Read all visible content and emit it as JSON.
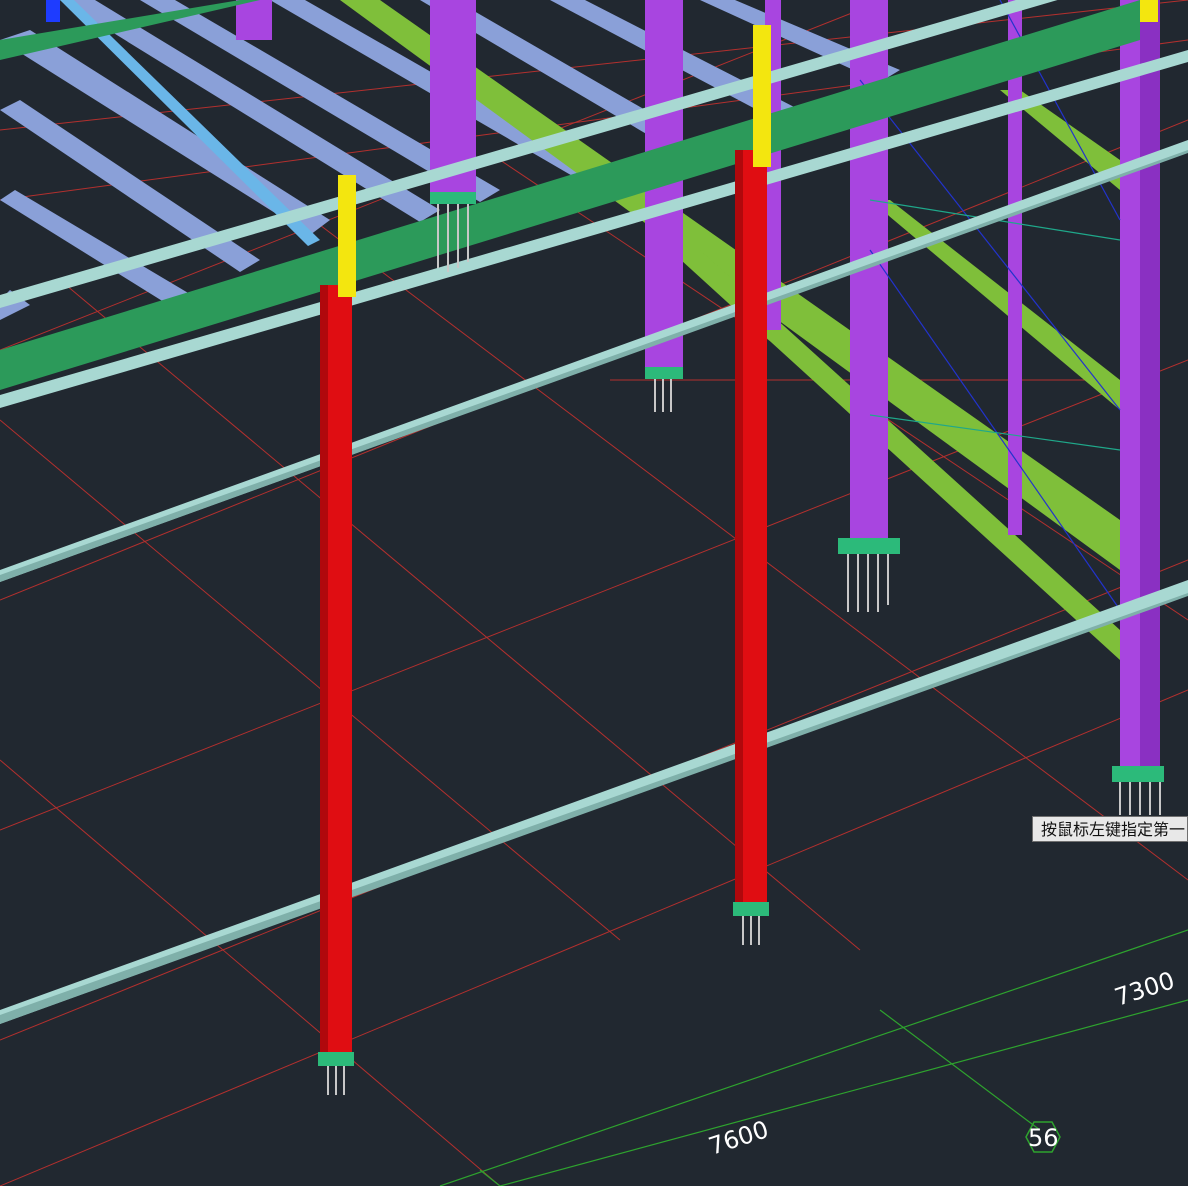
{
  "tooltip": {
    "text": "按鼠标左键指定第一"
  },
  "dimensions": {
    "left_span": "7600",
    "right_span": "7300"
  },
  "axis_marker": {
    "label": "56"
  },
  "colors": {
    "background": "#212830",
    "grid_line": "#b3302e",
    "dimension_line": "#2ea32e",
    "column_red": "#e00d12",
    "column_purple": "#a845e0",
    "beam_green": "#2c9a5a",
    "brace_olive": "#7fbf3a",
    "purlin_light": "#a8d8d2",
    "rafter_blue": "#8aa0d8",
    "stiffener_yellow": "#f3e60f"
  }
}
